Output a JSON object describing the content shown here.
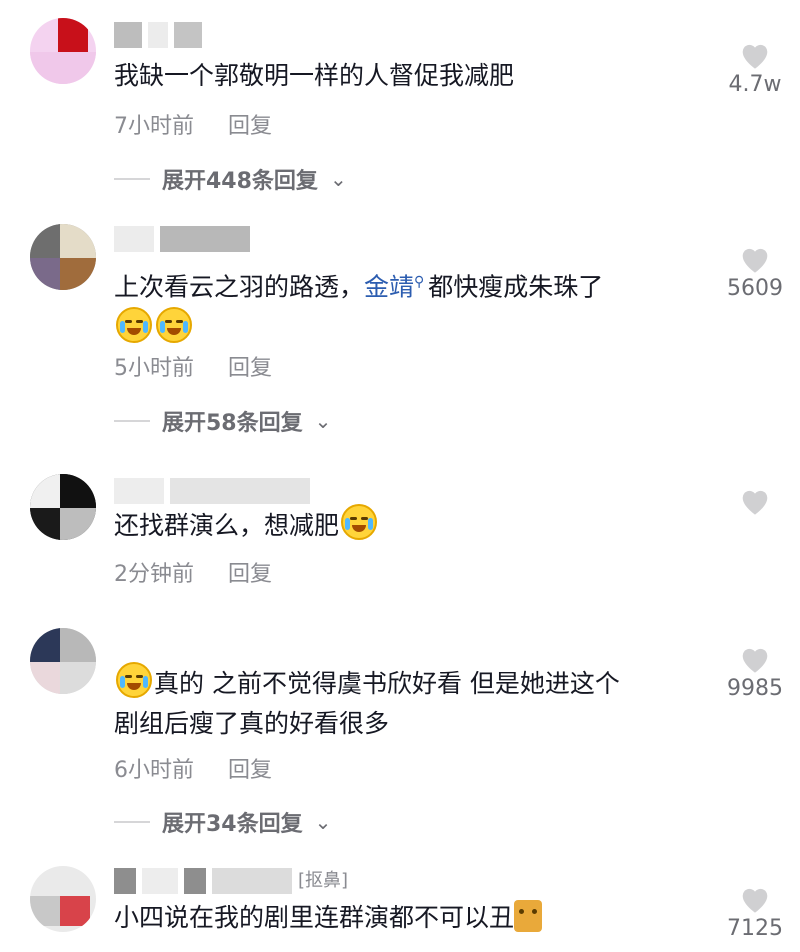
{
  "comments": [
    {
      "text": "我缺一个郭敬明一样的人督促我减肥",
      "time": "7小时前",
      "reply_label": "回复",
      "expand_label": "展开448条回复",
      "likes": "4.7w"
    },
    {
      "text_before": "上次看云之羽的路透，",
      "link": "金靖",
      "text_after": "都快瘦成朱珠了",
      "time": "5小时前",
      "reply_label": "回复",
      "expand_label": "展开58条回复",
      "likes": "5609"
    },
    {
      "text": "还找群演么，想减肥",
      "time": "2分钟前",
      "reply_label": "回复",
      "likes": ""
    },
    {
      "text_line1": "真的 之前不觉得虞书欣好看 但是她进这个",
      "text_line2": "剧组后瘦了真的好看很多",
      "time": "6小时前",
      "reply_label": "回复",
      "expand_label": "展开34条回复",
      "likes": "9985"
    },
    {
      "username_partial": "[抠鼻]",
      "text": "小四说在我的剧里连群演都不可以丑",
      "likes": "7125"
    }
  ],
  "icons": {
    "like": "heart-icon",
    "expand": "chevron-down-icon",
    "emoji_cry_laugh": "crying-laughing-emoji-icon",
    "emoji_cat": "cat-emoji-icon",
    "search": "search-icon"
  },
  "colors": {
    "text": "#161823",
    "meta": "#8a8b91",
    "link": "#2c5db0",
    "heart": "#d0d0d2"
  }
}
